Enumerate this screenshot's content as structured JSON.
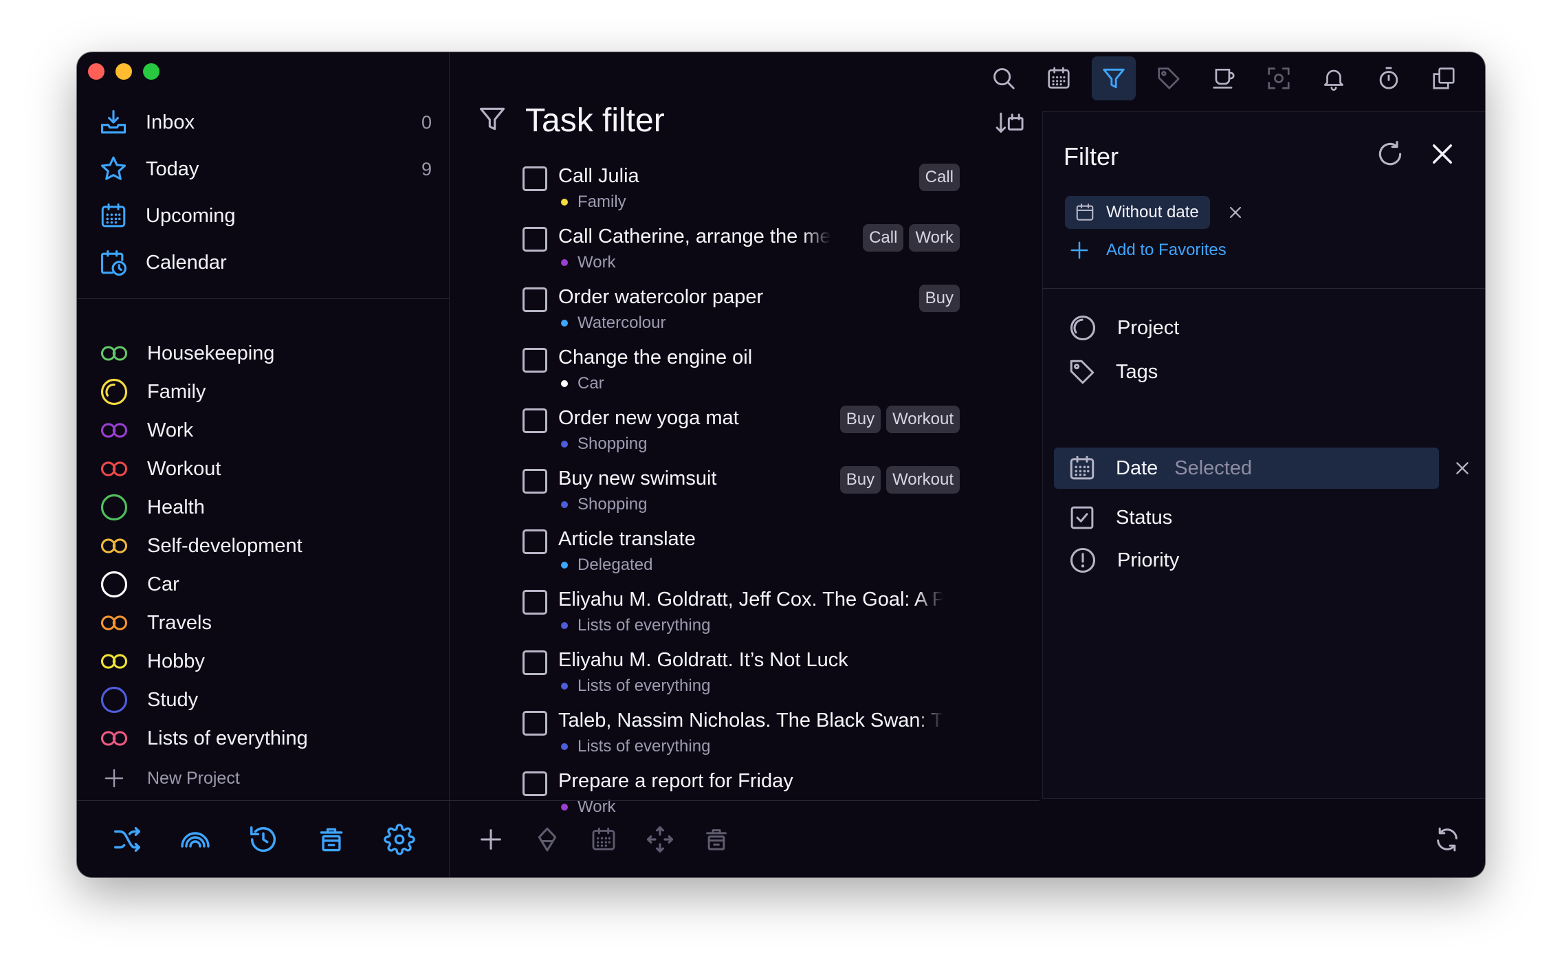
{
  "window": {
    "traffic_colors": [
      "#fe5f57",
      "#febc2e",
      "#28c840"
    ]
  },
  "sidebar": {
    "nav": [
      {
        "label": "Inbox",
        "count": "0",
        "icon": "inbox-icon"
      },
      {
        "label": "Today",
        "count": "9",
        "icon": "star-icon"
      },
      {
        "label": "Upcoming",
        "count": "",
        "icon": "calendar-grid-icon"
      },
      {
        "label": "Calendar",
        "count": "",
        "icon": "calendar-clock-icon"
      }
    ],
    "projects": [
      {
        "label": "Housekeeping",
        "color": "#63c966",
        "icon": "infinity-icon"
      },
      {
        "label": "Family",
        "color": "#f4db3e",
        "icon": "circle-progress-icon"
      },
      {
        "label": "Work",
        "color": "#9b3fd1",
        "icon": "infinity-icon"
      },
      {
        "label": "Workout",
        "color": "#ef4848",
        "icon": "infinity-icon"
      },
      {
        "label": "Health",
        "color": "#4fbf5c",
        "icon": "circle-icon"
      },
      {
        "label": "Self-development",
        "color": "#f0b83a",
        "icon": "infinity-icon"
      },
      {
        "label": "Car",
        "color": "#ffffff",
        "icon": "circle-icon"
      },
      {
        "label": "Travels",
        "color": "#f5952e",
        "icon": "infinity-icon"
      },
      {
        "label": "Hobby",
        "color": "#f2e333",
        "icon": "infinity-icon"
      },
      {
        "label": "Study",
        "color": "#4d5ddb",
        "icon": "circle-icon"
      },
      {
        "label": "Lists of everything",
        "color": "#ef5a82",
        "icon": "infinity-icon"
      }
    ],
    "new_project_label": "New Project",
    "bottom_icons": [
      "shuffle-icon",
      "rainbow-icon",
      "history-icon",
      "trash-icon",
      "settings-icon"
    ],
    "accent": "#3ea6ff"
  },
  "toolbar": {
    "icons": [
      "search-icon",
      "calendar-icon",
      "filter-icon",
      "tag-icon",
      "coffee-icon",
      "focus-icon",
      "bell-icon",
      "timer-icon",
      "windows-icon"
    ],
    "active": "filter-icon"
  },
  "main": {
    "title": "Task filter",
    "tasks": [
      {
        "title": "Call Julia",
        "project": "Family",
        "dot": "#f4db3e",
        "tags": [
          "Call"
        ]
      },
      {
        "title": "Call Catherine, arrange the meeting",
        "project": "Work",
        "dot": "#9b3fd1",
        "tags": [
          "Call",
          "Work"
        ]
      },
      {
        "title": "Order watercolor paper",
        "project": "Watercolour",
        "dot": "#3ea6ff",
        "tags": [
          "Buy"
        ]
      },
      {
        "title": "Change the engine oil",
        "project": "Car",
        "dot": "#ffffff",
        "tags": []
      },
      {
        "title": "Order new yoga mat",
        "project": "Shopping",
        "dot": "#4d5ddb",
        "tags": [
          "Buy",
          "Workout"
        ]
      },
      {
        "title": "Buy new swimsuit",
        "project": "Shopping",
        "dot": "#4d5ddb",
        "tags": [
          "Buy",
          "Workout"
        ]
      },
      {
        "title": "Article translate",
        "project": "Delegated",
        "dot": "#3ea6ff",
        "tags": []
      },
      {
        "title": "Eliyahu M. Goldratt, Jeff Cox. The Goal: A Process",
        "project": "Lists of everything",
        "dot": "#4d5ddb",
        "tags": []
      },
      {
        "title": "Eliyahu M. Goldratt. It’s Not Luck",
        "project": "Lists of everything",
        "dot": "#4d5ddb",
        "tags": []
      },
      {
        "title": "Taleb, Nassim Nicholas. The Black Swan: The",
        "project": "Lists of everything",
        "dot": "#4d5ddb",
        "tags": []
      },
      {
        "title": "Prepare a report for Friday",
        "project": "Work",
        "dot": "#9b3fd1",
        "tags": []
      }
    ],
    "bottom_icons": [
      "add-icon",
      "priority-icon",
      "calendar-icon",
      "move-icon",
      "trash-icon"
    ]
  },
  "filter": {
    "title": "Filter",
    "active_chip": "Without date",
    "add_favorites": "Add to Favorites",
    "rows": [
      {
        "label": "Project",
        "hint": "",
        "icon": "project-icon"
      },
      {
        "label": "Tags",
        "hint": "",
        "icon": "tag-icon"
      },
      {
        "label": "Date",
        "hint": "Selected",
        "icon": "calendar-icon",
        "selected": true
      },
      {
        "label": "Status",
        "hint": "",
        "icon": "checkbox-icon"
      },
      {
        "label": "Priority",
        "hint": "",
        "icon": "priority-icon"
      }
    ]
  }
}
